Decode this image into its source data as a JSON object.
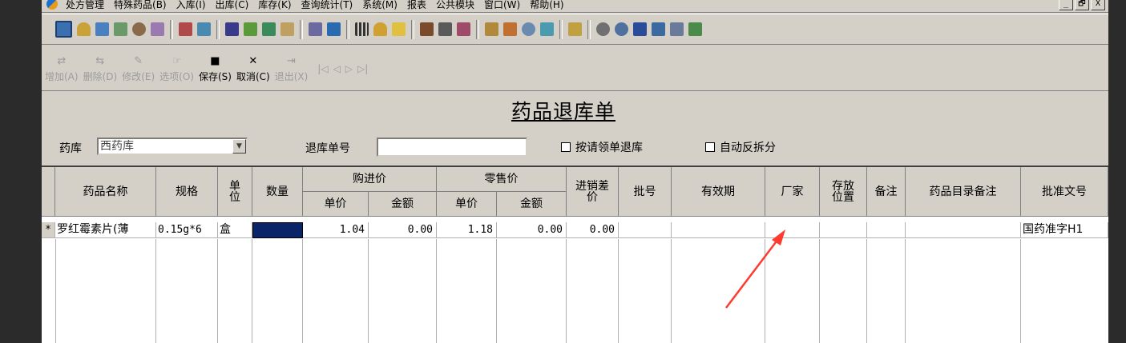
{
  "menu": {
    "items": [
      "处方管理",
      "特殊药品(B)",
      "入库(I)",
      "出库(C)",
      "库存(K)",
      "查询统计(T)",
      "系统(M)",
      "报表",
      "公共模块",
      "窗口(W)",
      "帮助(H)"
    ],
    "window_buttons": [
      "_",
      "🗗",
      "X"
    ]
  },
  "toolbar": {
    "actions": [
      {
        "label": "增加(A)",
        "glyph": "⇄",
        "enabled": false
      },
      {
        "label": "删除(D)",
        "glyph": "⇆",
        "enabled": false
      },
      {
        "label": "修改(E)",
        "glyph": "✎",
        "enabled": false
      },
      {
        "label": "选项(O)",
        "glyph": "☞",
        "enabled": false
      },
      {
        "label": "保存(S)",
        "glyph": "■",
        "enabled": true
      },
      {
        "label": "取消(C)",
        "glyph": "✕",
        "enabled": true
      },
      {
        "label": "退出(X)",
        "glyph": "⇥",
        "enabled": false
      }
    ],
    "nav": [
      "|◁",
      "◁",
      "▷",
      "▷|"
    ]
  },
  "form": {
    "title": "药品退库单",
    "warehouse_label": "药库",
    "warehouse_value": "西药库",
    "return_no_label": "退库单号",
    "return_no_value": "",
    "checkbox_requisition": "按请领单退库",
    "checkbox_auto_split": "自动反拆分"
  },
  "grid": {
    "headers": {
      "name": "药品名称",
      "spec": "规格",
      "unit": "单位",
      "qty": "数量",
      "purchase": "购进价",
      "retail": "零售价",
      "unit_price": "单价",
      "amount": "金额",
      "diff": "进销差价",
      "batch": "批号",
      "expiry": "有效期",
      "maker": "厂家",
      "location": "存放位置",
      "note": "备注",
      "catalog_note": "药品目录备注",
      "approval": "批准文号"
    },
    "rows": [
      {
        "marker": "*",
        "name": "罗红霉素片(薄",
        "spec": "0.15g*6",
        "unit": "盒",
        "qty": "",
        "purchase_price": "1.04",
        "purchase_amount": "0.00",
        "retail_price": "1.18",
        "retail_amount": "0.00",
        "diff": "0.00",
        "batch": "",
        "expiry": "",
        "maker": "",
        "location": "",
        "note": "",
        "catalog_note": "",
        "approval": "国药准字H1"
      }
    ]
  },
  "colors": {
    "window_bg": "#d4d0c8",
    "selected_cell": "#0a246a",
    "annotation_arrow": "#ff3b30"
  }
}
